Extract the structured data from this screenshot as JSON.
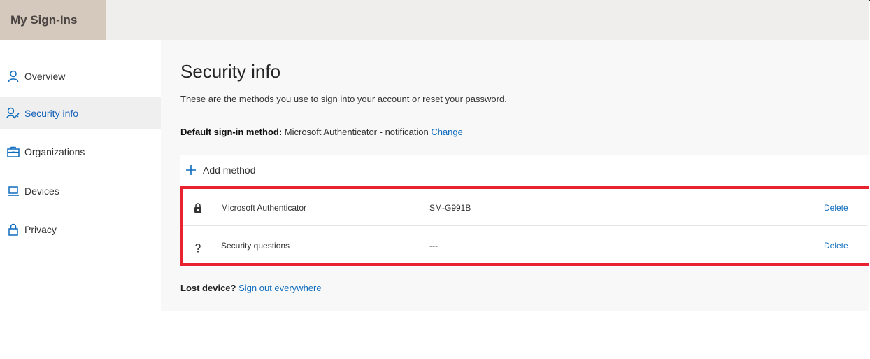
{
  "header": {
    "brand": "My Sign-Ins"
  },
  "sidebar": {
    "items": [
      {
        "label": "Overview",
        "icon": "person-icon",
        "active": false
      },
      {
        "label": "Security info",
        "icon": "person-key-icon",
        "active": true
      },
      {
        "label": "Organizations",
        "icon": "briefcase-icon",
        "active": false
      },
      {
        "label": "Devices",
        "icon": "laptop-icon",
        "active": false
      },
      {
        "label": "Privacy",
        "icon": "lock-icon",
        "active": false
      }
    ]
  },
  "main": {
    "title": "Security info",
    "subtitle": "These are the methods you use to sign into your account or reset your password.",
    "default_method": {
      "label": "Default sign-in method:",
      "value": " Microsoft Authenticator - notification ",
      "change_link": "Change"
    },
    "add_method": "Add method",
    "methods": [
      {
        "icon": "authenticator-lock-icon",
        "name": "Microsoft Authenticator",
        "detail": "SM-G991B",
        "action": "Delete"
      },
      {
        "icon": "question-icon",
        "name": "Security questions",
        "detail": "---",
        "action": "Delete"
      }
    ],
    "lost_device": {
      "label": "Lost device?",
      "link": " Sign out everywhere"
    }
  },
  "colors": {
    "accent": "#0f6cbd",
    "highlight": "#e8222f",
    "brand_bg": "#d5c9bd",
    "topbar_bg": "#f0eeec",
    "content_bg": "#f8f8f8"
  }
}
